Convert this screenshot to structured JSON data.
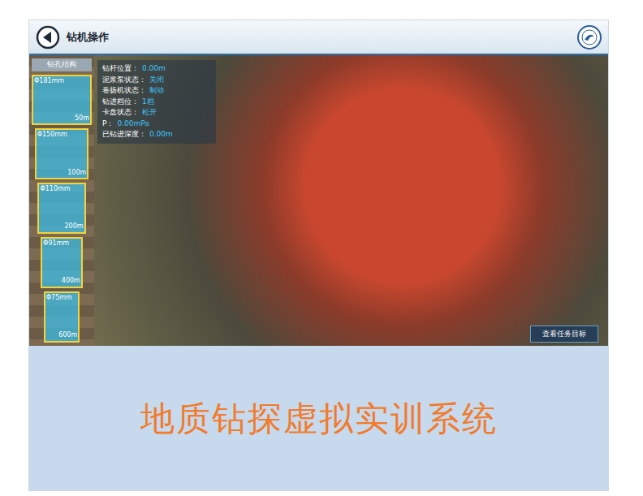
{
  "header": {
    "title": "钻机操作"
  },
  "hole_structure": {
    "title": "钻孔结构",
    "segments": [
      {
        "diameter": "Φ181mm",
        "depth": "50m"
      },
      {
        "diameter": "Φ150mm",
        "depth": "100m"
      },
      {
        "diameter": "Φ110mm",
        "depth": "200m"
      },
      {
        "diameter": "Φ91mm",
        "depth": "400m"
      },
      {
        "diameter": "Φ75mm",
        "depth": "600m"
      }
    ]
  },
  "status_panel": [
    {
      "label": "钻杆位置：",
      "value": "0.00m"
    },
    {
      "label": "泥浆泵状态：",
      "value": "关闭"
    },
    {
      "label": "卷扬机状态：",
      "value": "制动"
    },
    {
      "label": "钻进档位：",
      "value": "1档"
    },
    {
      "label": "卡盘状态：",
      "value": "松开"
    },
    {
      "label": "P：",
      "value": "0.00mPa"
    },
    {
      "label": "已钻进深度：",
      "value": "0.00m"
    }
  ],
  "task_button": "查看任务目标",
  "caption": "地质钻探虚拟实训系统"
}
